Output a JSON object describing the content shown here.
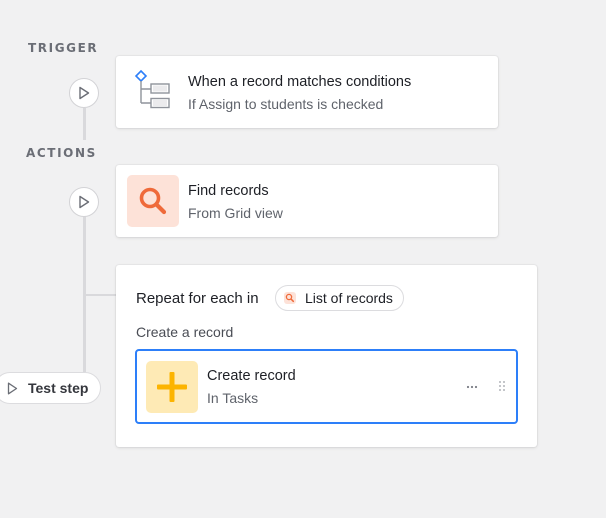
{
  "trigger_section": {
    "label": "TRIGGER",
    "card": {
      "title": "When a record matches conditions",
      "subtitle": "If Assign to students is checked",
      "icon": "conditions-tree-icon"
    }
  },
  "actions_section": {
    "label": "ACTIONS",
    "find_card": {
      "title": "Find records",
      "subtitle": "From Grid view",
      "icon": "search-icon"
    },
    "repeat_card": {
      "title": "Repeat for each in",
      "chip_label": "List of records",
      "chip_icon": "search-icon",
      "sub_label": "Create a record",
      "inner_card": {
        "title": "Create record",
        "subtitle": "In Tasks",
        "icon": "plus-icon",
        "more_icon": "more-horizontal-icon",
        "drag_icon": "drag-handle-icon"
      }
    }
  },
  "test_step": {
    "label": "Test step",
    "icon": "play-icon"
  },
  "colors": {
    "background": "#f1f1f2",
    "selected_border": "#2d7ff9",
    "find_tile_bg": "#fde2d8",
    "find_icon": "#ef6a3a",
    "create_tile_bg": "#feeab5",
    "create_icon": "#fcb400",
    "tree_icon_blue": "#2d7ff9",
    "tree_icon_gray": "#8f939b"
  }
}
